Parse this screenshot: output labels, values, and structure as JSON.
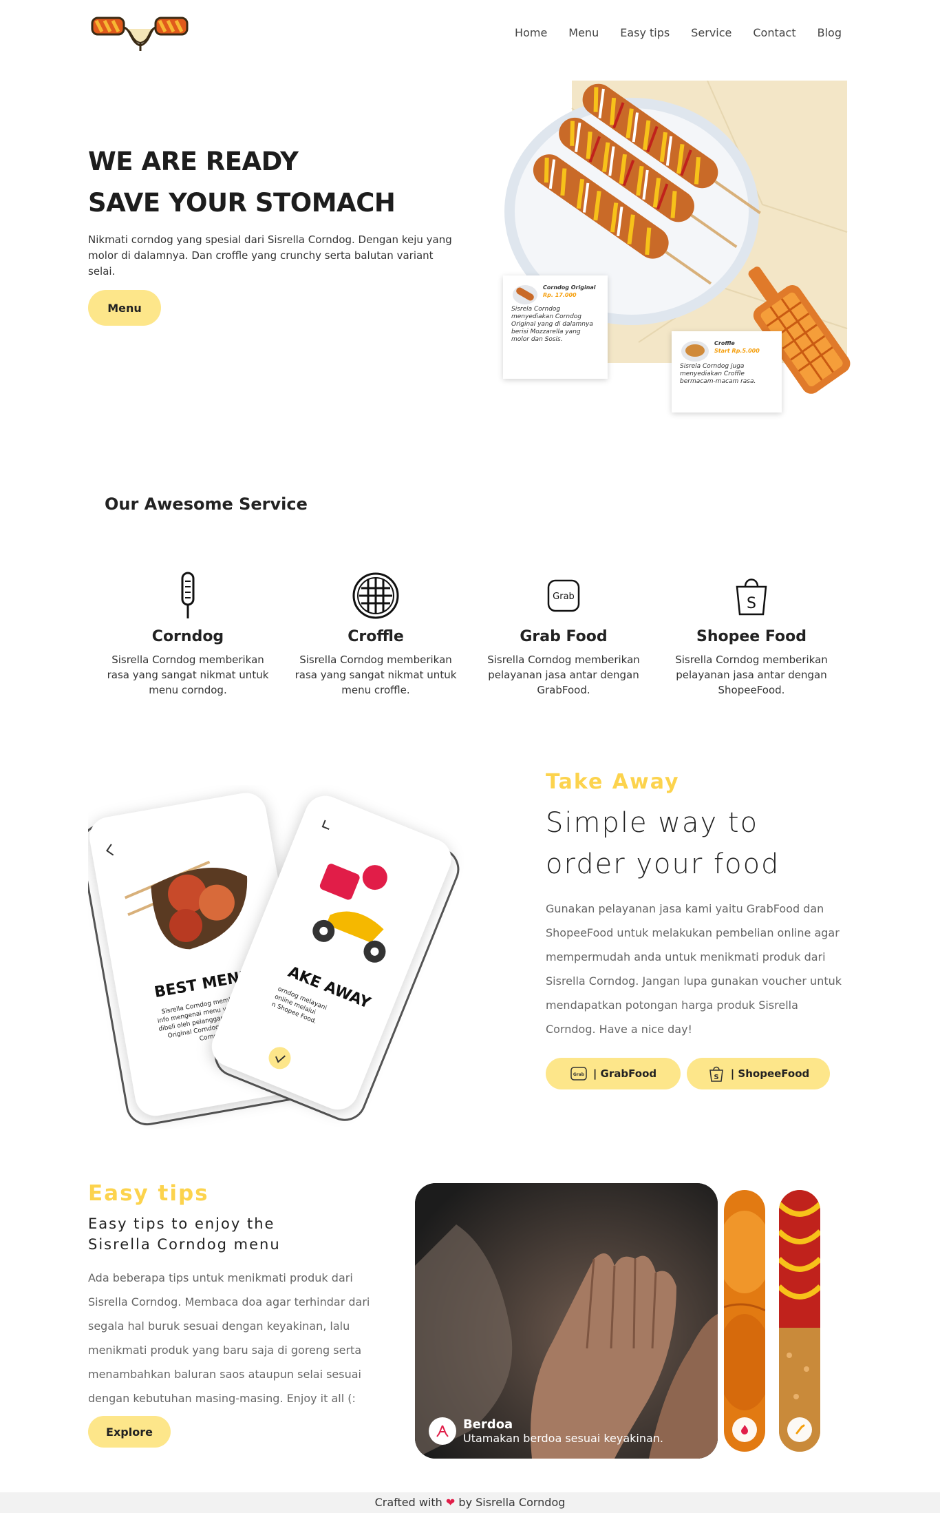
{
  "nav": {
    "items": [
      "Home",
      "Menu",
      "Easy tips",
      "Service",
      "Contact",
      "Blog"
    ]
  },
  "hero": {
    "title_line1": "WE ARE READY",
    "title_line2": "SAVE YOUR STOMACH",
    "text": "Nikmati corndog yang spesial dari Sisrella Corndog. Dengan keju yang molor di dalamnya. Dan croffle yang crunchy serta balutan variant selai.",
    "button": "Menu",
    "card1": {
      "title": "Corndog Original",
      "price": "Rp. 17.000",
      "desc": "Sisrela Corndog menyediakan Corndog Original yang di dalamnya berisi Mozzarella yang molor dan Sosis."
    },
    "card2": {
      "title": "Croffle",
      "price": "Start Rp.5.000",
      "desc": "Sisrela Corndog juga menyediakan Croffle bermacam-macam rasa."
    }
  },
  "services": {
    "title": "Our Awesome Service",
    "items": [
      {
        "name": "Corndog",
        "desc": "Sisrella Corndog memberikan rasa yang sangat nikmat untuk menu corndog.",
        "icon": "corndog-icon"
      },
      {
        "name": "Croffle",
        "desc": "Sisrella Corndog memberikan rasa yang sangat nikmat untuk menu croffle.",
        "icon": "waffle-icon"
      },
      {
        "name": "Grab Food",
        "desc": "Sisrella Corndog memberikan pelayanan jasa antar dengan GrabFood.",
        "icon": "grab-icon"
      },
      {
        "name": "Shopee Food",
        "desc": "Sisrella Corndog memberikan pelayanan jasa antar dengan ShopeeFood.",
        "icon": "shopee-icon"
      }
    ]
  },
  "takeaway": {
    "label": "Take Away",
    "heading_line1": "Simple way to",
    "heading_line2": "order your food",
    "text": "Gunakan pelayanan jasa kami yaitu GrabFood dan ShopeeFood untuk melakukan pembelian online agar mempermudah anda untuk menikmati produk dari Sisrella Corndog. Jangan lupa gunakan voucher untuk mendapatkan potongan harga produk Sisrella Corndog. Have a nice day!",
    "grab_button": "| GrabFood",
    "shopee_button": "| ShopeeFood",
    "grab_mini": "Grab",
    "phone1": {
      "title": "BEST MENU",
      "desc": "Sisrella Corndog memberikan info mengenai menu yang sering dibeli oleh pelanggan kami, yaitu Original Corndog dan Potato Corndog"
    },
    "phone2": {
      "title": "AKE AWAY",
      "desc": "orndog melayani online melalui n Shopee Food."
    }
  },
  "tips": {
    "label": "Easy tips",
    "heading_line1": "Easy tips to enjoy the",
    "heading_line2": "Sisrella Corndog menu",
    "text": "Ada beberapa tips untuk menikmati produk dari Sisrella Corndog. Membaca doa agar terhindar dari segala hal buruk sesuai dengan keyakinan, lalu menikmati produk yang baru saja di goreng serta menambahkan baluran saos ataupun selai sesuai dengan kebutuhan masing-masing. Enjoy it all (:",
    "button": "Explore",
    "photo_title": "Berdoa",
    "photo_sub": "Utamakan berdoa sesuai keyakinan."
  },
  "footer": {
    "before": "Crafted with",
    "after": "by Sisrella Corndog"
  },
  "colors": {
    "accent": "#fcd34d",
    "button": "#fde68a"
  }
}
